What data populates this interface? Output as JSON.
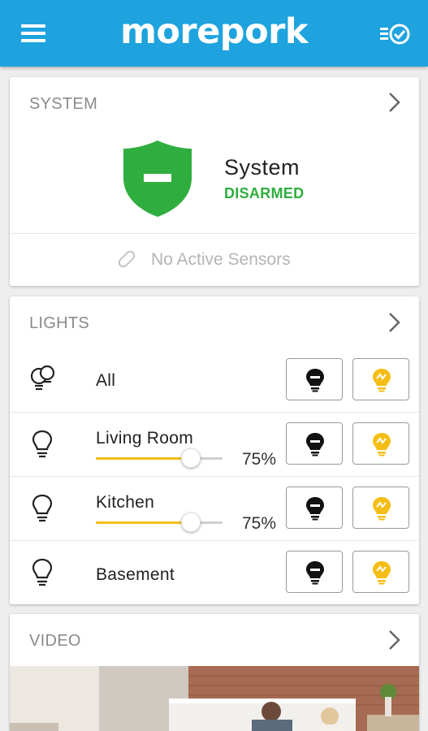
{
  "app": {
    "title": "morepork"
  },
  "system": {
    "section_title": "SYSTEM",
    "name": "System",
    "status": "DISARMED",
    "status_color": "#2fae3f",
    "sensors_text": "No Active Sensors"
  },
  "lights": {
    "section_title": "LIGHTS",
    "rows": [
      {
        "label": "All",
        "icon": "bulbs-group-icon"
      },
      {
        "label": "Living Room",
        "icon": "bulb-outline-icon",
        "level": 75,
        "level_text": "75%"
      },
      {
        "label": "Kitchen",
        "icon": "bulb-outline-icon",
        "level": 75,
        "level_text": "75%"
      },
      {
        "label": "Basement",
        "icon": "bulb-outline-icon"
      }
    ]
  },
  "video": {
    "section_title": "VIDEO"
  },
  "colors": {
    "brand": "#1ea3de",
    "accent": "#f5be16",
    "armed_ok": "#2fae3f"
  }
}
